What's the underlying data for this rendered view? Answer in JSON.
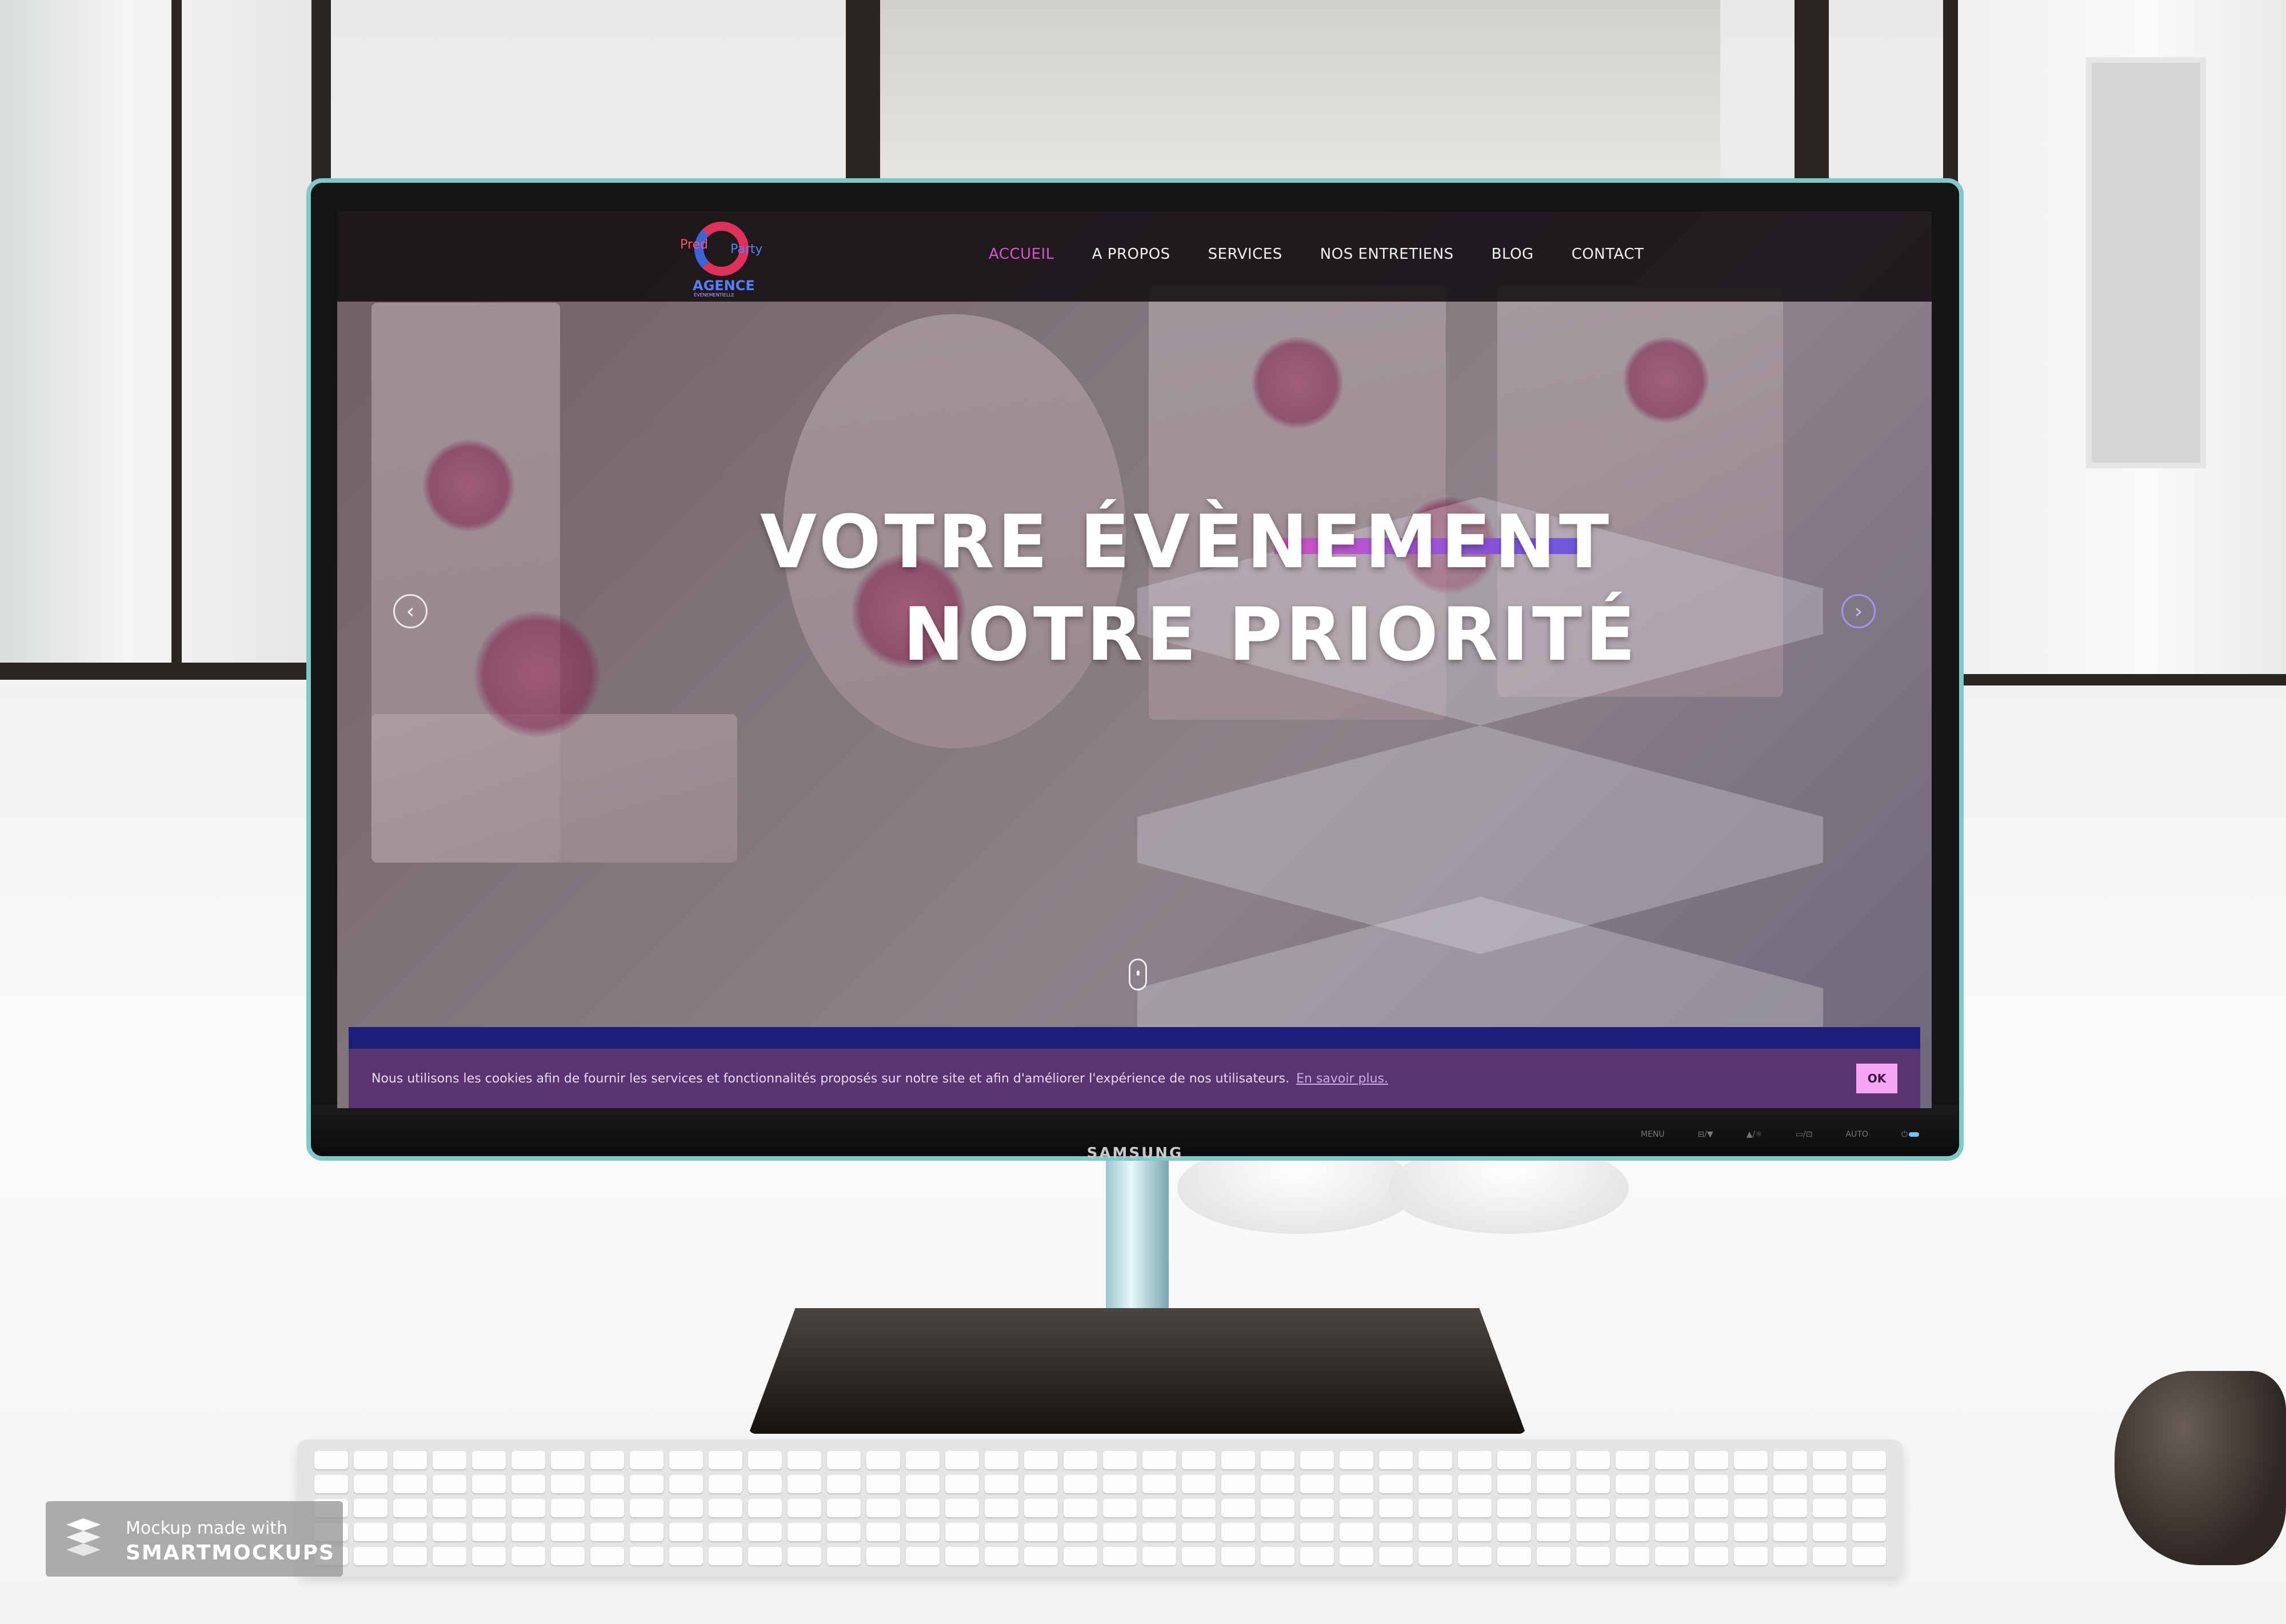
{
  "website": {
    "logo": {
      "text_pred": "Pred",
      "text_party": "Party",
      "text_agence": "AGENCE",
      "text_sub": "ÉVÈNEMENTIELLE"
    },
    "nav": [
      {
        "label": "ACCUEIL",
        "active": true
      },
      {
        "label": "A PROPOS",
        "active": false
      },
      {
        "label": "SERVICES",
        "active": false
      },
      {
        "label": "NOS ENTRETIENS",
        "active": false
      },
      {
        "label": "BLOG",
        "active": false
      },
      {
        "label": "CONTACT",
        "active": false
      }
    ],
    "hero": {
      "line1": "VOTRE ÉVÈNEMENT",
      "line2": "NOTRE PRIORITÉ",
      "prev_icon": "‹",
      "next_icon": "›"
    },
    "cookie": {
      "text": "Nous utilisons les cookies afin de fournir les services et fonctionnalités proposés sur notre site et afin d'améliorer l'expérience de nos utilisateurs.",
      "link": "En savoir plus.",
      "ok": "OK"
    },
    "colors": {
      "accent": "#e24fd0",
      "cookie_bg": "#5a3470",
      "ok_bg": "#f7a4f4",
      "blue_bar": "#1d1e7a"
    }
  },
  "monitor": {
    "brand": "SAMSUNG",
    "controls": [
      "MENU",
      "⊟/▼",
      "▲/☼",
      "▭/⊡",
      "AUTO",
      "⏻"
    ]
  },
  "watermark": {
    "line1": "Mockup made with",
    "line2": "SMARTMOCKUPS"
  }
}
